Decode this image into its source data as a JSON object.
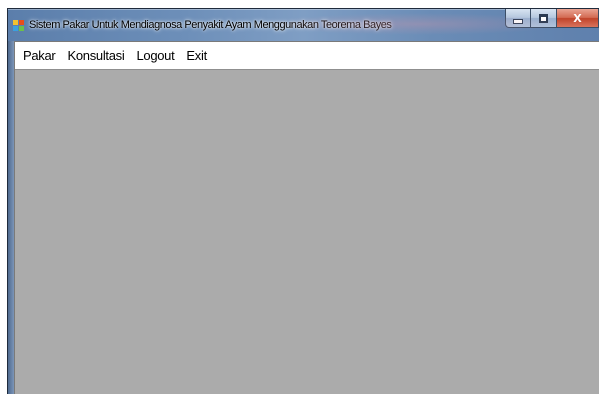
{
  "window": {
    "title": "Sistem Pakar Untuk Mendiagnosa Penyakit Ayam Menggunakan Teorema Bayes",
    "icon": "app-icon",
    "controls": {
      "minimize_icon": "minimize-icon",
      "maximize_icon": "maximize-icon",
      "close_label": "X"
    }
  },
  "menubar": {
    "items": [
      {
        "label": "Pakar"
      },
      {
        "label": "Konsultasi"
      },
      {
        "label": "Logout"
      },
      {
        "label": "Exit"
      }
    ]
  },
  "colors": {
    "title_bar": "#6d8fb9",
    "mdi_background": "#ababab",
    "menu_background": "#ffffff",
    "close_button": "#c0432a"
  }
}
